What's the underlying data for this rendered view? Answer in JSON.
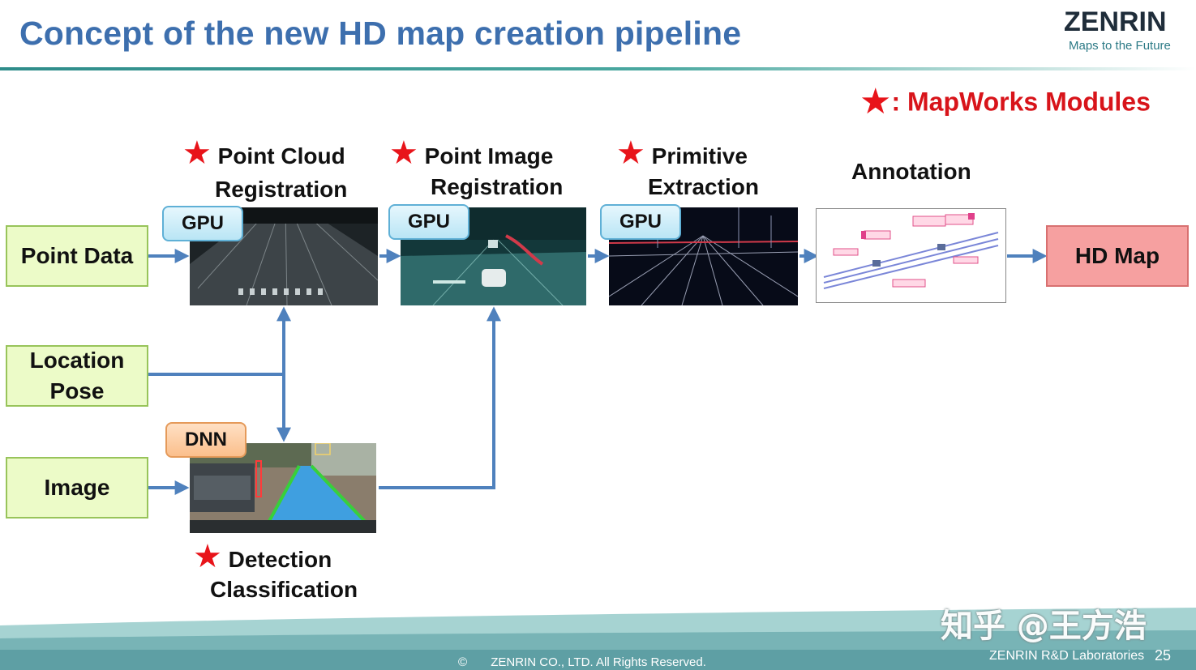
{
  "slide": {
    "title": "Concept of the new HD map creation pipeline",
    "logo": {
      "name": "ZENRIN",
      "tagline": "Maps to the Future"
    },
    "legend": {
      "star": "★",
      "text": ": MapWorks Modules"
    },
    "inputs": {
      "point_data": "Point Data",
      "location_line1": "Location",
      "location_line2": "Pose",
      "image": "Image"
    },
    "stages": {
      "point_cloud": {
        "line1": "Point Cloud",
        "line2": "Registration",
        "badge": "GPU"
      },
      "point_image": {
        "line1": "Point Image",
        "line2": "Registration",
        "badge": "GPU"
      },
      "primitive": {
        "line1": "Primitive",
        "line2": "Extraction",
        "badge": "GPU"
      },
      "annotation": {
        "line1": "Annotation"
      },
      "detection": {
        "line1": "Detection",
        "line2": "Classification",
        "badge": "DNN"
      }
    },
    "output": "HD Map",
    "colors": {
      "arrow": "#4f81bd",
      "star": "#e8141a",
      "title": "#3d6fae",
      "input_fill": "#ecfbc8",
      "output_fill": "#f6a0a0"
    },
    "footer": {
      "watermark": "知乎 @王方浩",
      "copyright_symbol": "©",
      "copyright": "ZENRIN CO., LTD. All Rights Reserved.",
      "lab": "ZENRIN R&D Laboratories",
      "page": "25"
    }
  }
}
